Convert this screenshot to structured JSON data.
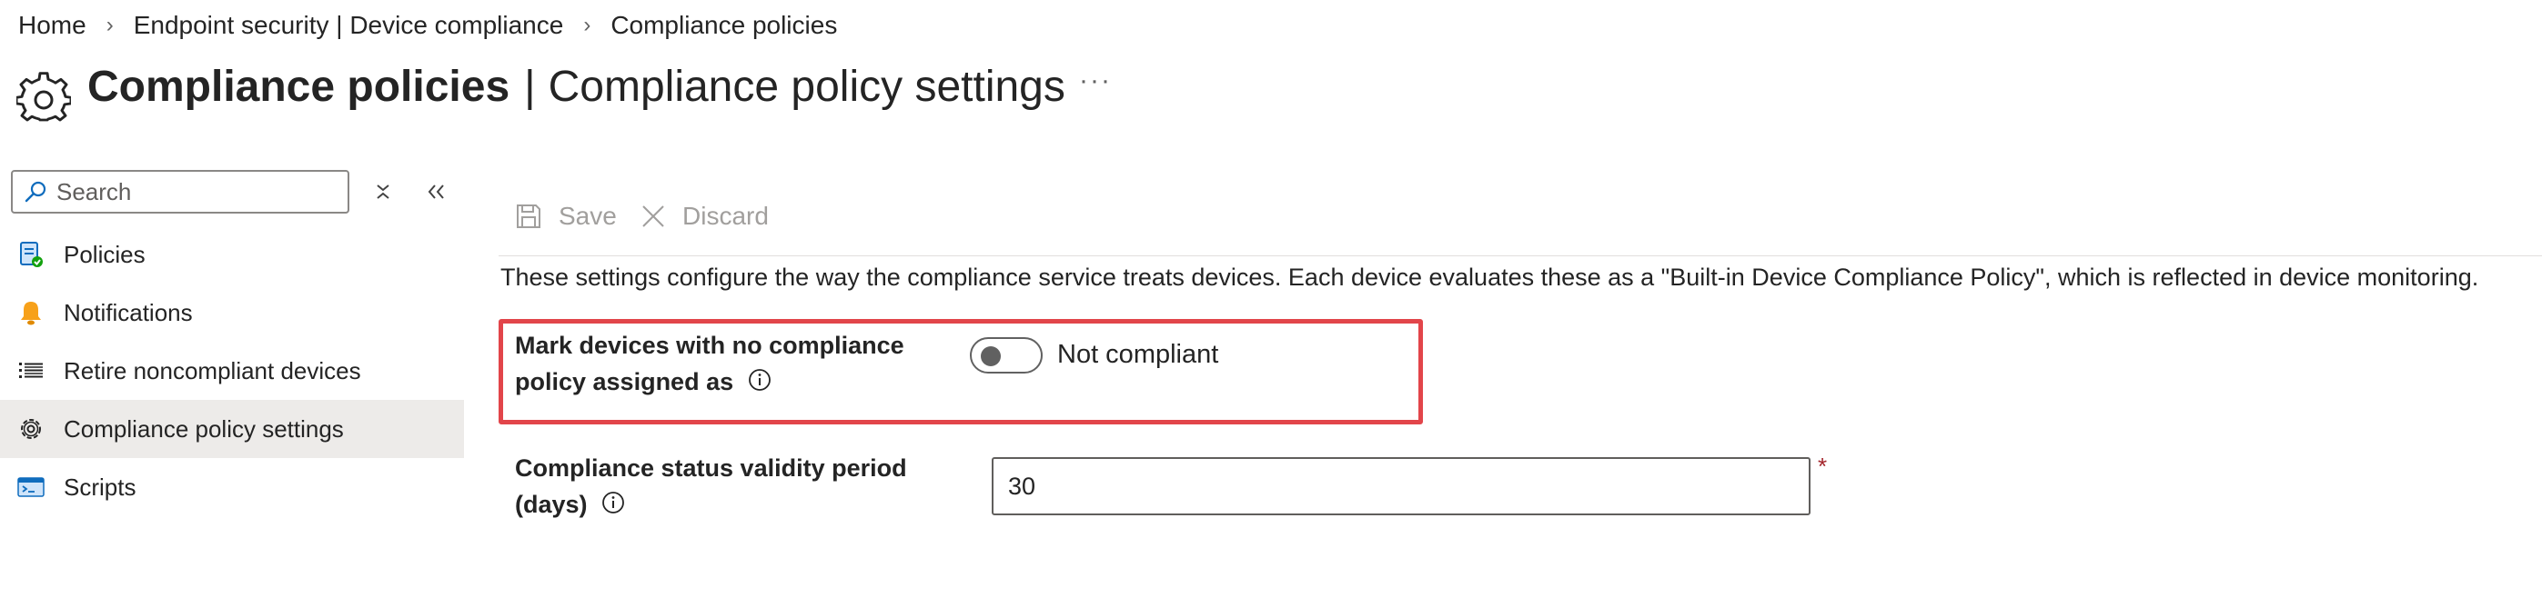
{
  "breadcrumb": {
    "items": [
      "Home",
      "Endpoint security | Device compliance",
      "Compliance policies"
    ],
    "separator": "›"
  },
  "header": {
    "title": "Compliance policies",
    "divider": "|",
    "subtitle": "Compliance policy settings",
    "more": "···"
  },
  "search": {
    "placeholder": "Search",
    "value": ""
  },
  "sidebar": {
    "items": [
      {
        "label": "Policies",
        "icon": "policies-icon",
        "active": false
      },
      {
        "label": "Notifications",
        "icon": "bell-icon",
        "active": false
      },
      {
        "label": "Retire noncompliant devices",
        "icon": "list-icon",
        "active": false
      },
      {
        "label": "Compliance policy settings",
        "icon": "gear-icon",
        "active": true
      },
      {
        "label": "Scripts",
        "icon": "scripts-icon",
        "active": false
      }
    ]
  },
  "toolbar": {
    "save_label": "Save",
    "discard_label": "Discard"
  },
  "main": {
    "description": "These settings configure the way the compliance service treats devices. Each device evaluates these as a \"Built-in Device Compliance Policy\", which is reflected in device monitoring.",
    "setting1": {
      "label_line1": "Mark devices with no compliance",
      "label_line2": "policy assigned as",
      "toggle_on": false,
      "toggle_label": "Not compliant"
    },
    "setting2": {
      "label_line1": "Compliance status validity period",
      "label_line2": "(days)",
      "value": "30",
      "required_mark": "*"
    }
  },
  "colors": {
    "highlight": "#e2454a",
    "active_nav_bg": "#edebe9",
    "required": "#a4262c",
    "disabled_text": "#a19f9d"
  }
}
